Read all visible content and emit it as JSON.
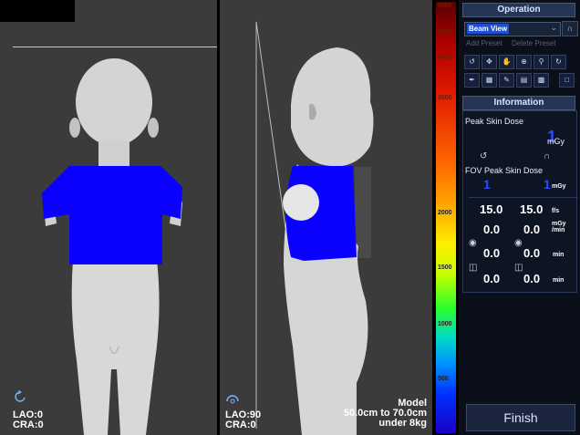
{
  "left_view": {
    "angles": {
      "lao": "LAO:0",
      "cra": "CRA:0"
    }
  },
  "right_view": {
    "angles": {
      "lao": "LAO:90",
      "cra": "CRA:0"
    },
    "model": {
      "line1": "Model",
      "line2": "50.0cm to 70.0cm",
      "line3": "under 8kg"
    }
  },
  "scale": {
    "ticks": [
      "8000",
      "6000",
      "4000",
      "3000",
      "2000",
      "1500",
      "1000",
      "500"
    ]
  },
  "operation": {
    "title": "Operation",
    "view_select": "Beam View",
    "add_preset": "Add Preset",
    "delete_preset": "Delete Preset"
  },
  "information": {
    "title": "Information",
    "peak_skin_dose_label": "Peak Skin Dose",
    "peak_skin_dose_value": "1",
    "peak_skin_dose_unit": "mGy",
    "fov_peak_label": "FOV Peak Skin Dose",
    "fov_value_left": "1",
    "fov_value_right": "1",
    "fov_unit": "mGy",
    "rate_left": "15.0",
    "rate_right": "15.0",
    "rate_unit": "f/s",
    "dose_rate_left": "0.0",
    "dose_rate_right": "0.0",
    "dose_rate_unit": "mGy /min",
    "fluoro_left": "0.0",
    "fluoro_right": "0.0",
    "fluoro_unit": "min",
    "acq_left": "0.0",
    "acq_right": "0.0",
    "acq_unit": "min"
  },
  "finish_label": "Finish",
  "colors": {
    "dose_blue": "#0a00ff",
    "model_gray": "#d4d4d4",
    "panel_bg": "#0a0f1a"
  }
}
